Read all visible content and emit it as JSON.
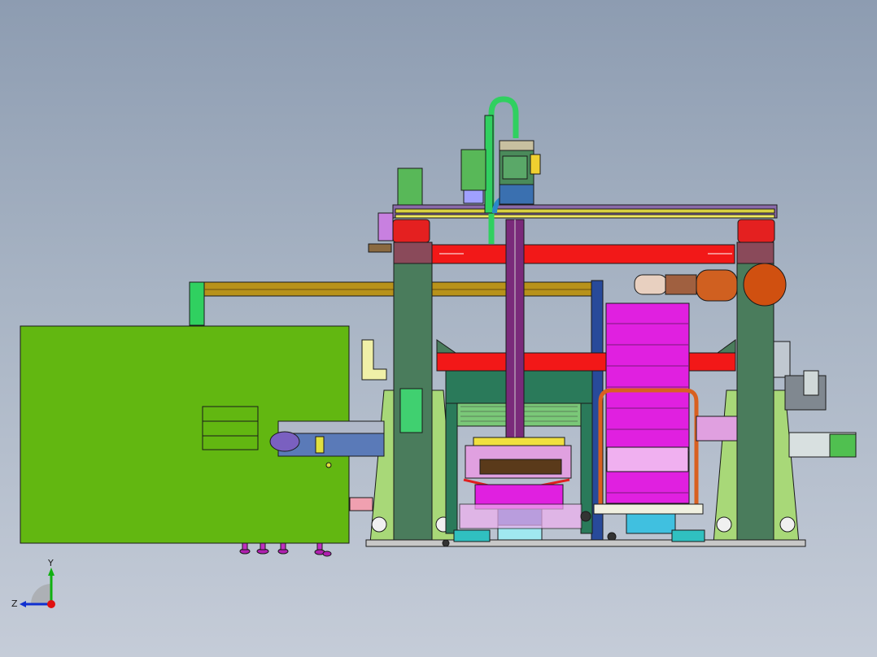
{
  "triad": {
    "y_label": "Y",
    "z_label": "Z",
    "x_color": "#e01010",
    "y_color": "#10b010",
    "z_color": "#1030d0"
  },
  "colors": {
    "background_top": "#8d9cb1",
    "background_bottom": "#c5ccd8",
    "enclosure": "#62b711",
    "column": "#4a7c5c",
    "crossbeam": "#f21818",
    "pallet_cage": "#e020e0",
    "gantry_rail": "#d8d040",
    "robot_arm": "#d06020",
    "outline": "#1a1a1a"
  }
}
